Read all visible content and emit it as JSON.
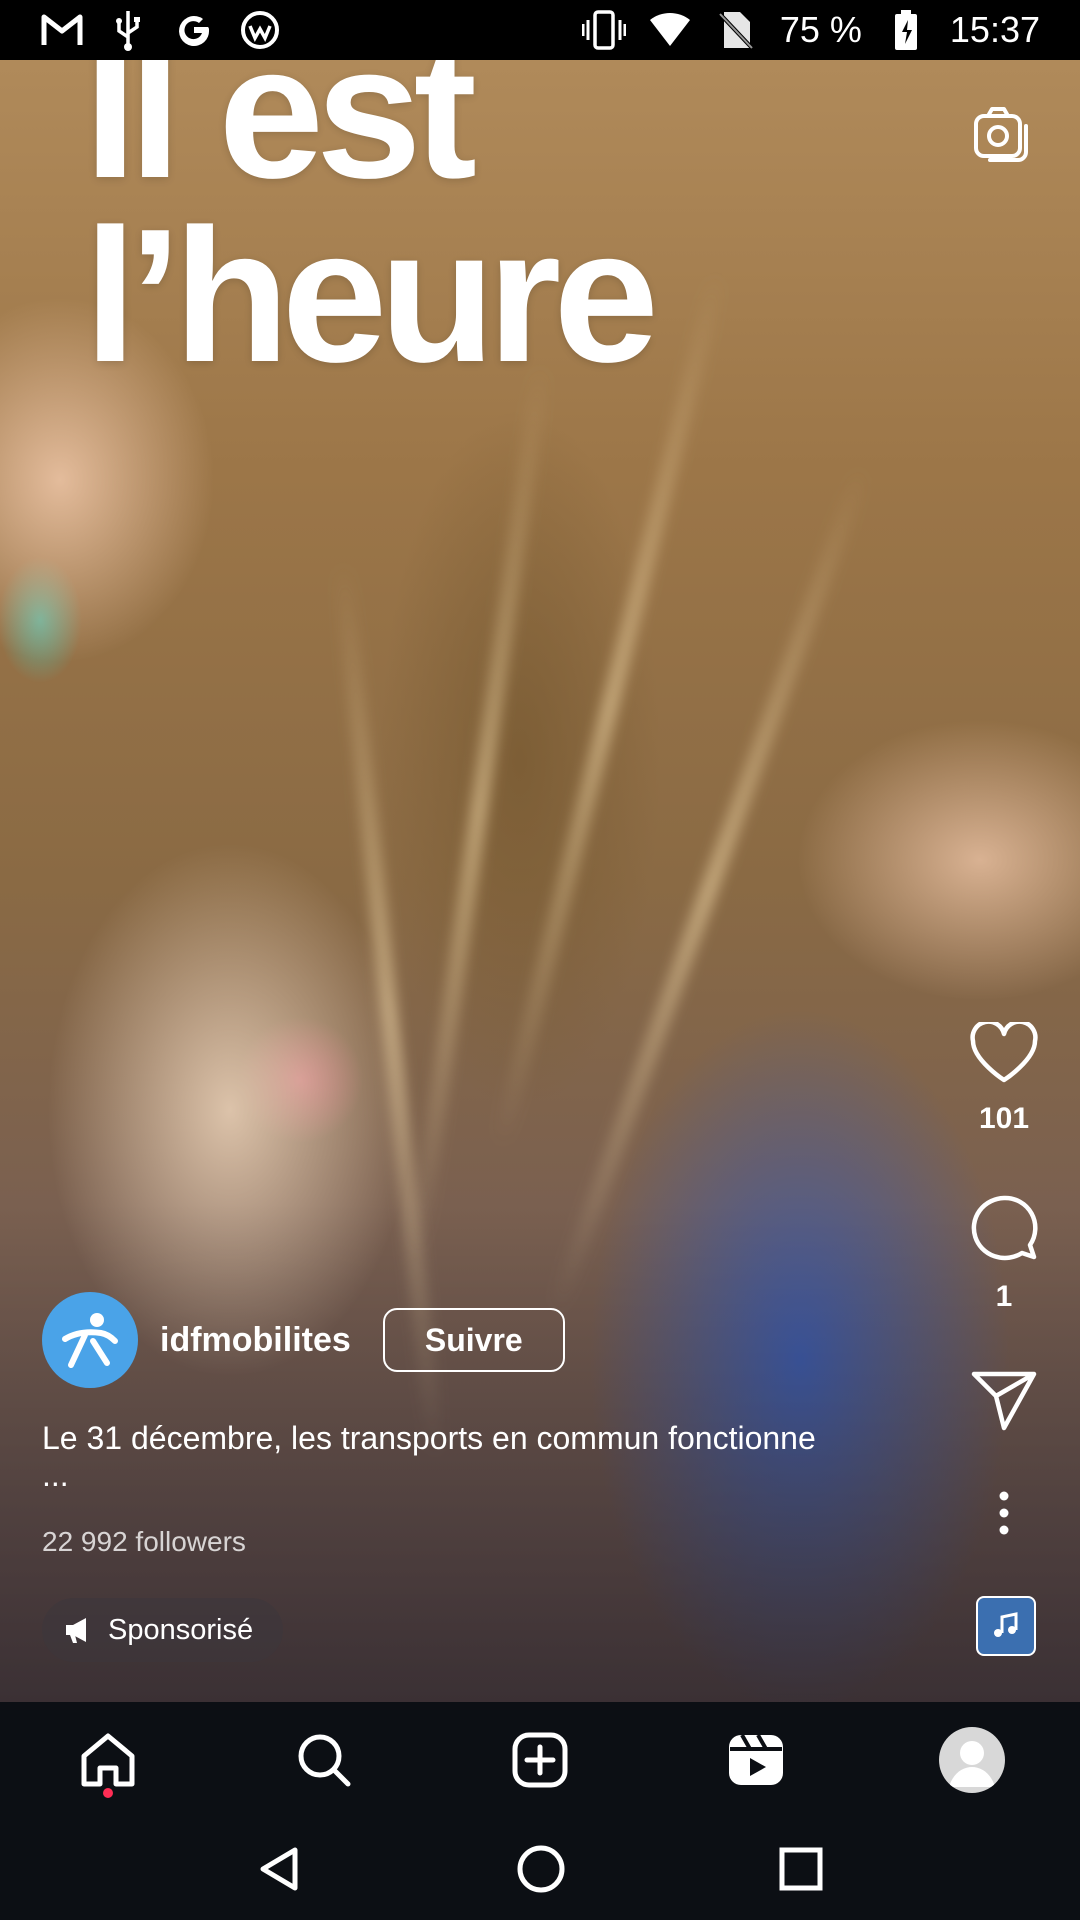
{
  "status_bar": {
    "battery_percent": "75 %",
    "time": "15:37",
    "icons": [
      "gmail-icon",
      "usb-icon",
      "google-icon",
      "app-icon",
      "vibrate-icon",
      "wifi-icon",
      "no-sim-icon",
      "battery-charging-icon"
    ]
  },
  "reel": {
    "overlay_line1": "Il est",
    "overlay_line2": "l’heure",
    "likes": "101",
    "comments": "1",
    "username": "idfmobilites",
    "follow_label": "Suivre",
    "caption": "Le 31 décembre, les transports en commun fonctionne",
    "caption_more": "...",
    "followers": "22 992 followers",
    "sponsored_label": "Sponsorisé"
  },
  "bottom_nav": {
    "items": [
      "home-icon",
      "search-icon",
      "create-icon",
      "reels-icon",
      "profile-avatar"
    ]
  },
  "system_nav": [
    "back-button",
    "home-button",
    "recents-button"
  ],
  "colors": {
    "accent_dot": "#ff2d55",
    "brand_logo": "#4aa3e8",
    "nav_background": "#0c0f14"
  }
}
